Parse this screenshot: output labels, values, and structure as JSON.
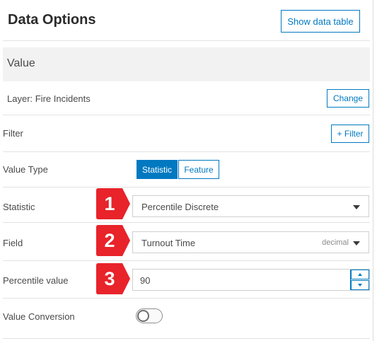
{
  "panel": {
    "title": "Data Options",
    "show_table_label": "Show data table"
  },
  "section": {
    "title": "Value"
  },
  "layer": {
    "label": "Layer: Fire Incidents",
    "change_label": "Change"
  },
  "filter": {
    "label": "Filter",
    "add_label": "+ Filter"
  },
  "value_type": {
    "label": "Value Type",
    "options": [
      "Statistic",
      "Feature"
    ],
    "selected": "Statistic"
  },
  "statistic": {
    "label": "Statistic",
    "value": "Percentile Discrete"
  },
  "field": {
    "label": "Field",
    "value": "Turnout Time",
    "type_hint": "decimal"
  },
  "percentile": {
    "label": "Percentile value",
    "value": "90"
  },
  "value_conversion": {
    "label": "Value Conversion",
    "enabled": false
  },
  "callouts": [
    "1",
    "2",
    "3"
  ],
  "colors": {
    "accent": "#0079c1",
    "callout": "#e8232a"
  }
}
